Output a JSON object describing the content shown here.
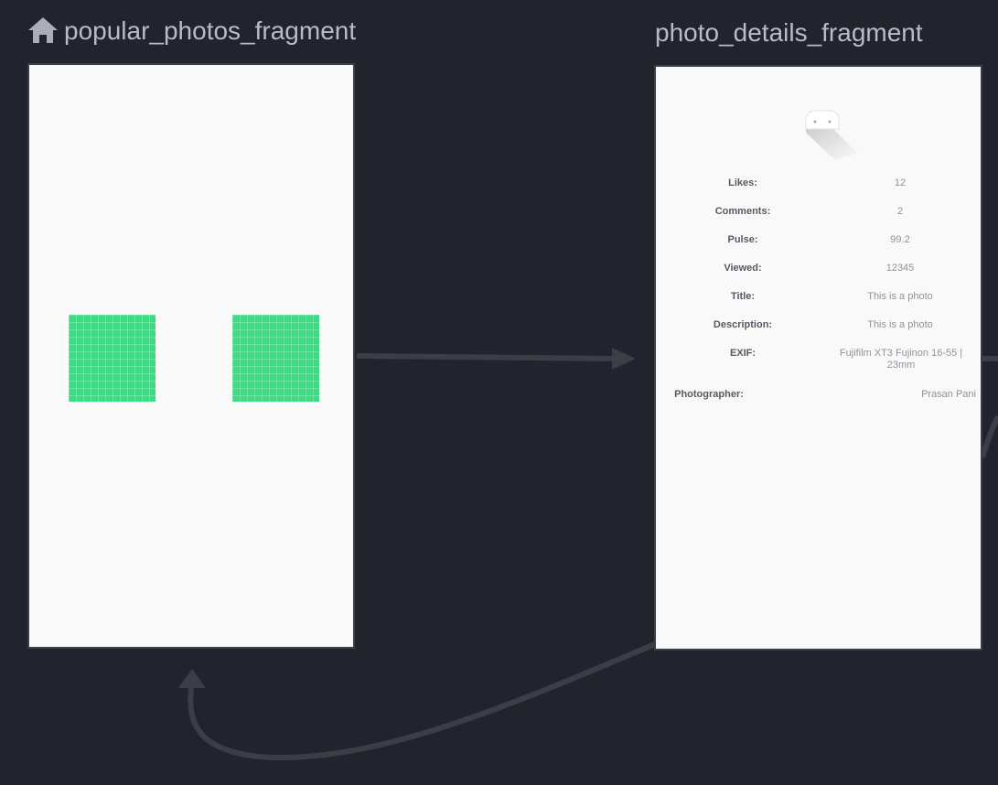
{
  "colors": {
    "background": "#21242c",
    "screen": "#f9f9f9",
    "title_text": "#b7bcc6",
    "arrow": "#3a3e47",
    "thumbnail": "#3ddc84"
  },
  "destinations": [
    {
      "id": "popular_photos_fragment",
      "title": "popular_photos_fragment",
      "is_start_destination": true,
      "icon": "home-icon",
      "thumbnail_icon": "image-placeholder-icon"
    },
    {
      "id": "photo_details_fragment",
      "title": "photo_details_fragment",
      "icon": "image-placeholder-icon",
      "rows": [
        {
          "label": "Likes:",
          "value": "12"
        },
        {
          "label": "Comments:",
          "value": "2"
        },
        {
          "label": "Pulse:",
          "value": "99.2"
        },
        {
          "label": "Viewed:",
          "value": "12345"
        },
        {
          "label": "Title:",
          "value": "This is a photo"
        },
        {
          "label": "Description:",
          "value": "This is a photo"
        },
        {
          "label": "EXIF:",
          "value": "Fujifilm XT3 Fujinon 16-55 | 23mm"
        },
        {
          "label": "Photographer:",
          "value": "Prasan Pani"
        }
      ]
    }
  ],
  "actions": [
    {
      "from": "popular_photos_fragment",
      "to": "photo_details_fragment"
    },
    {
      "from": "photo_details_fragment",
      "to": "popular_photos_fragment"
    }
  ]
}
